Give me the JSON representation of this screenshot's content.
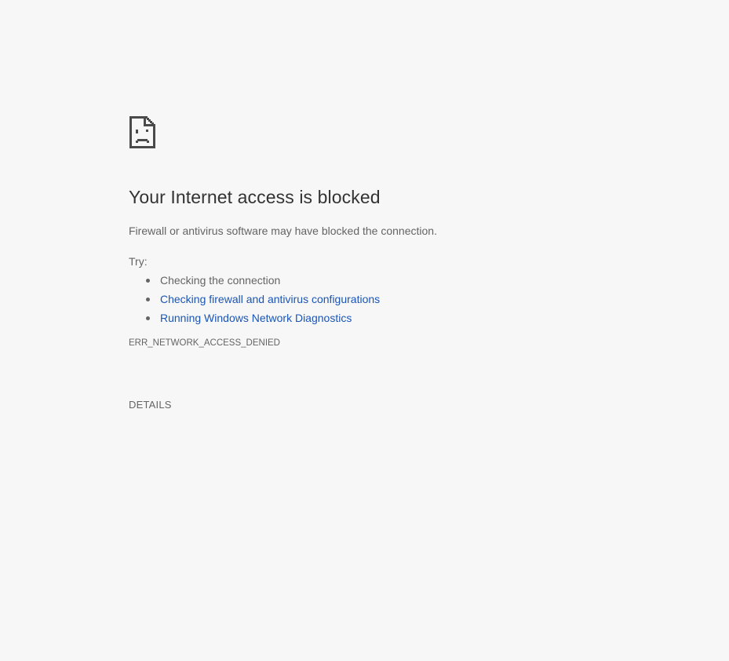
{
  "error_page": {
    "icon": "sad-document-icon",
    "title": "Your Internet access is blocked",
    "subtitle": "Firewall or antivirus software may have blocked the connection.",
    "try_label": "Try:",
    "suggestions": [
      {
        "label": "Checking the connection",
        "is_link": false
      },
      {
        "label": "Checking firewall and antivirus configurations",
        "is_link": true
      },
      {
        "label": "Running Windows Network Diagnostics",
        "is_link": true
      }
    ],
    "error_code": "ERR_NETWORK_ACCESS_DENIED",
    "details_button": "DETAILS"
  },
  "colors": {
    "background": "#f7f7f7",
    "title_text": "#333333",
    "body_text": "#646464",
    "link": "#1a55b6"
  }
}
